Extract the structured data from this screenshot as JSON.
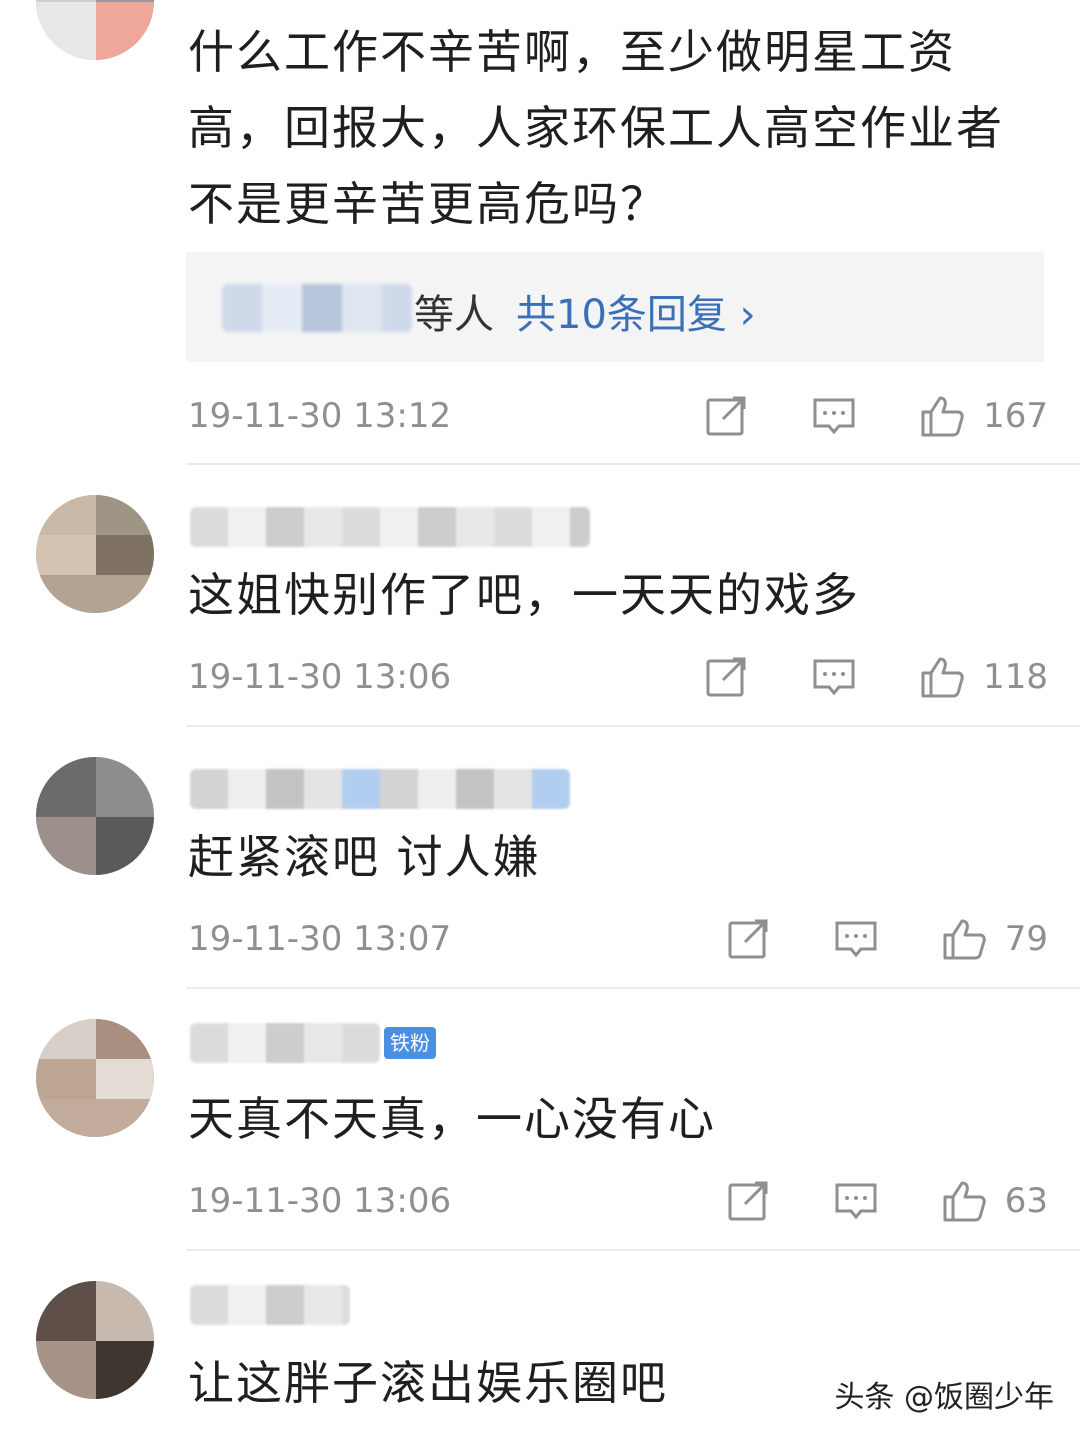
{
  "comments": [
    {
      "text": "什么工作不辛苦啊，至少做明星工资高，回报大，人家环保工人高空作业者不是更辛苦更高危吗？",
      "reply_preview": {
        "who_suffix": "等人",
        "link": "共10条回复 ›"
      },
      "time": "19-11-30 13:12",
      "likes": "167"
    },
    {
      "text": "这姐快别作了吧，一天天的戏多",
      "time": "19-11-30 13:06",
      "likes": "118"
    },
    {
      "text": "赶紧滚吧  讨人嫌",
      "time": "19-11-30 13:07",
      "likes": "79"
    },
    {
      "text": "天真不天真，一心没有心",
      "badge": "铁粉",
      "time": "19-11-30 13:06",
      "likes": "63"
    },
    {
      "text": "让这胖子滚出娱乐圈吧"
    }
  ],
  "icons": {
    "share": "share-icon",
    "comment": "comment-icon",
    "like": "thumbs-up-icon"
  },
  "colors": {
    "link": "#3b6fb6",
    "meta": "#8f8f8f",
    "badge": "#4a90e2"
  },
  "watermark": "头条 @饭圈少年"
}
